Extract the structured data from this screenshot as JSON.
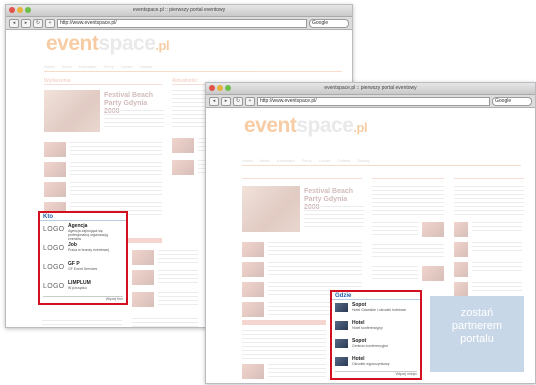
{
  "window1": {
    "tab_title": "eventspace.pl :: pierwszy portal eventowy",
    "url": "http://www.eventspace.pl/",
    "search_label": "Google",
    "nav_items": [
      "Home",
      "News",
      "Kalendarz",
      "Firmy",
      "Ludzie",
      "Galeria",
      "Szukaj"
    ],
    "featured_title": "Festival Beach Party Gdynia 2008",
    "section_news": "Wydarzenia",
    "section_right": "Aktualności",
    "callout": {
      "header": "Kto",
      "items": [
        {
          "logo": "LOGO",
          "title": "Agencja",
          "desc": "Agencja zajmująca się profesjonalną organizacją eventów"
        },
        {
          "logo": "LOGO",
          "title": "Job",
          "desc": "Praca w branży eventowej"
        },
        {
          "logo": "LOGO",
          "title": "GF P",
          "desc": "GF Event Services"
        },
        {
          "logo": "LOGO",
          "title": "LIMPLUM",
          "desc": "W porządku"
        }
      ],
      "footer": "Więcej firm"
    }
  },
  "window2": {
    "tab_title": "eventspace.pl :: pierwszy portal eventowy",
    "url": "http://www.eventspace.pl/",
    "search_label": "Google",
    "nav_items": [
      "Home",
      "News",
      "Kalendarz",
      "Firmy",
      "Ludzie",
      "Galeria",
      "Szukaj"
    ],
    "featured_title": "Festival Beach Party Gdynia 2008",
    "logo_main": "event",
    "logo_space": "space",
    "logo_tld": ".pl",
    "callout": {
      "header": "Gdzie",
      "items": [
        {
          "title": "Sopot",
          "desc": "Hotel Gdańskie i ośrodek hotelowe"
        },
        {
          "title": "Hotel",
          "desc": "Hotel konferencyjny"
        },
        {
          "title": "Sopot",
          "desc": "Centrum konferencyjne"
        },
        {
          "title": "Hotel",
          "desc": "Ośrodek wypoczynkowy"
        }
      ],
      "footer": "Więcej miejsc"
    },
    "promo_lines": [
      "zostań",
      "partnerem",
      "portalu"
    ]
  },
  "colors": {
    "callout_border": "#d21020",
    "callout_header": "#215fa4",
    "logo_orange": "#f2a45a",
    "promo_bg": "#c8d7e8"
  }
}
